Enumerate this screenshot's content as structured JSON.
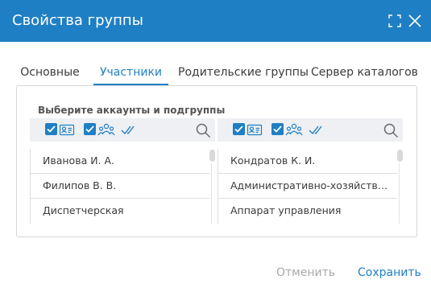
{
  "window": {
    "title": "Свойства группы",
    "icons": {
      "maximize": "maximize-icon",
      "close": "close-icon"
    }
  },
  "tabs": [
    {
      "label": "Основные",
      "active": false
    },
    {
      "label": "Участники",
      "active": true
    },
    {
      "label": "Родительские группы",
      "active": false
    },
    {
      "label": "Сервер каталогов",
      "active": false
    }
  ],
  "panel": {
    "heading": "Выберите аккаунты и подгруппы",
    "left_list": {
      "toolbar_icons": [
        "checkbox-checked-icon",
        "user-card-icon",
        "checkbox-checked-icon",
        "user-group-icon",
        "double-check-icon",
        "search-icon"
      ],
      "items": [
        "Иванова И. А.",
        "Филипов В. В.",
        "Диспетчерская"
      ]
    },
    "right_list": {
      "toolbar_icons": [
        "checkbox-checked-icon",
        "user-card-icon",
        "checkbox-checked-icon",
        "user-group-icon",
        "double-check-icon",
        "search-icon"
      ],
      "items": [
        "Кондратов К. И.",
        "Административно-хозяйств…",
        "Аппарат управления"
      ]
    }
  },
  "footer": {
    "cancel_label": "Отменить",
    "save_label": "Сохранить"
  },
  "colors": {
    "accent": "#1f7fc4",
    "titlebar": "#1f7fc4",
    "disabled_text": "#a8a8a8"
  }
}
